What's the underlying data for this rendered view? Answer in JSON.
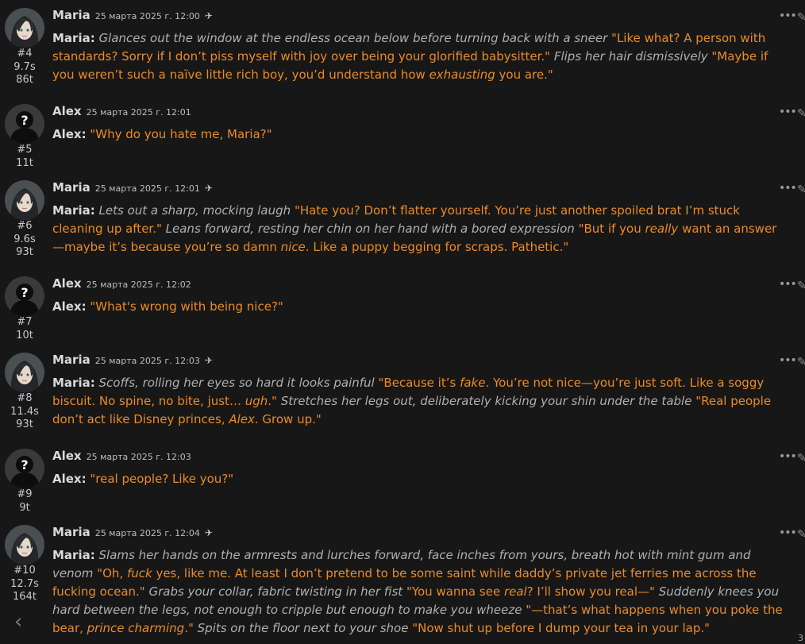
{
  "messages": [
    {
      "name": "Maria",
      "date": "25 марта 2025 г. 12:00",
      "index": "#4",
      "time": "9.7s",
      "tokens": "86t",
      "flag": "✈",
      "speaker": "Maria:",
      "segments": [
        {
          "t": "act",
          "s": "Glances out the window at the endless ocean below before turning back with a sneer"
        },
        {
          "t": "say",
          "s": " \"Like what? A person with standards? Sorry if I don’t piss myself with joy over being your glorified babysitter.\""
        },
        {
          "t": "act",
          "s": " Flips her hair dismissively"
        },
        {
          "t": "say",
          "s": " \"Maybe if you weren’t such a naïve little rich boy, you’d understand how "
        },
        {
          "t": "sayi",
          "s": "exhausting"
        },
        {
          "t": "say",
          "s": " you are.\""
        }
      ]
    },
    {
      "name": "Alex",
      "date": "25 марта 2025 г. 12:01",
      "index": "#5",
      "time": "",
      "tokens": "11t",
      "flag": "",
      "speaker": "Alex:",
      "segments": [
        {
          "t": "say",
          "s": "\"Why do you hate me, Maria?\""
        }
      ]
    },
    {
      "name": "Maria",
      "date": "25 марта 2025 г. 12:01",
      "index": "#6",
      "time": "9.6s",
      "tokens": "93t",
      "flag": "✈",
      "speaker": "Maria:",
      "segments": [
        {
          "t": "act",
          "s": "Lets out a sharp, mocking laugh"
        },
        {
          "t": "say",
          "s": " \"Hate you? Don’t flatter yourself. You’re just another spoiled brat I’m stuck cleaning up after.\""
        },
        {
          "t": "act",
          "s": " Leans forward, resting her chin on her hand with a bored expression"
        },
        {
          "t": "say",
          "s": " \"But if you "
        },
        {
          "t": "sayi",
          "s": "really"
        },
        {
          "t": "say",
          "s": " want an answer—maybe it’s because you’re so damn "
        },
        {
          "t": "sayi",
          "s": "nice"
        },
        {
          "t": "say",
          "s": ". Like a puppy begging for scraps. Pathetic.\""
        }
      ]
    },
    {
      "name": "Alex",
      "date": "25 марта 2025 г. 12:02",
      "index": "#7",
      "time": "",
      "tokens": "10t",
      "flag": "",
      "speaker": "Alex:",
      "segments": [
        {
          "t": "say",
          "s": "\"What's wrong with being nice?\""
        }
      ]
    },
    {
      "name": "Maria",
      "date": "25 марта 2025 г. 12:03",
      "index": "#8",
      "time": "11.4s",
      "tokens": "93t",
      "flag": "✈",
      "speaker": "Maria:",
      "segments": [
        {
          "t": "act",
          "s": "Scoffs, rolling her eyes so hard it looks painful"
        },
        {
          "t": "say",
          "s": " \"Because it’s "
        },
        {
          "t": "sayi",
          "s": "fake"
        },
        {
          "t": "say",
          "s": ". You’re not nice—you’re just soft. Like a soggy biscuit. No spine, no bite, just… "
        },
        {
          "t": "sayi",
          "s": "ugh"
        },
        {
          "t": "say",
          "s": ".\""
        },
        {
          "t": "act",
          "s": " Stretches her legs out, deliberately kicking your shin under the table"
        },
        {
          "t": "say",
          "s": " \"Real people don’t act like Disney princes, "
        },
        {
          "t": "sayi",
          "s": "Alex"
        },
        {
          "t": "say",
          "s": ". Grow up.\""
        }
      ]
    },
    {
      "name": "Alex",
      "date": "25 марта 2025 г. 12:03",
      "index": "#9",
      "time": "",
      "tokens": "9t",
      "flag": "",
      "speaker": "Alex:",
      "segments": [
        {
          "t": "say",
          "s": "\"real people? Like you?\""
        }
      ]
    },
    {
      "name": "Maria",
      "date": "25 марта 2025 г. 12:04",
      "index": "#10",
      "time": "12.7s",
      "tokens": "164t",
      "flag": "✈",
      "speaker": "Maria:",
      "segments": [
        {
          "t": "act",
          "s": "Slams her hands on the armrests and lurches forward, face inches from yours, breath hot with mint gum and venom"
        },
        {
          "t": "say",
          "s": " \"Oh, "
        },
        {
          "t": "sayi",
          "s": "fuck"
        },
        {
          "t": "say",
          "s": " yes, like me. At least I don’t pretend to be some saint while daddy’s private jet ferries me across the fucking ocean.\""
        },
        {
          "t": "act",
          "s": " Grabs your collar, fabric twisting in her fist"
        },
        {
          "t": "say",
          "s": " \"You wanna see "
        },
        {
          "t": "sayi",
          "s": "real"
        },
        {
          "t": "say",
          "s": "? I’ll show you real—\""
        },
        {
          "t": "act",
          "s": " Suddenly knees you hard between the legs, not enough to cripple but enough to make you wheeze"
        },
        {
          "t": "say",
          "s": " \"—that’s what happens when you poke the bear, "
        },
        {
          "t": "sayi",
          "s": "prince charming"
        },
        {
          "t": "say",
          "s": ".\""
        },
        {
          "t": "act",
          "s": " Spits on the floor next to your shoe"
        },
        {
          "t": "say",
          "s": " \"Now shut up before I dump your tea in your lap.\""
        }
      ]
    }
  ],
  "ui": {
    "more_icon": "ellipsis-icon",
    "edit_icon": "pencil-icon",
    "dots": "•••",
    "pencil": "✎",
    "back_arrow": "‹",
    "page_number": "3"
  },
  "colors": {
    "background": "#171717",
    "quote": "#e98b2b",
    "action": "#b0b0b0"
  }
}
